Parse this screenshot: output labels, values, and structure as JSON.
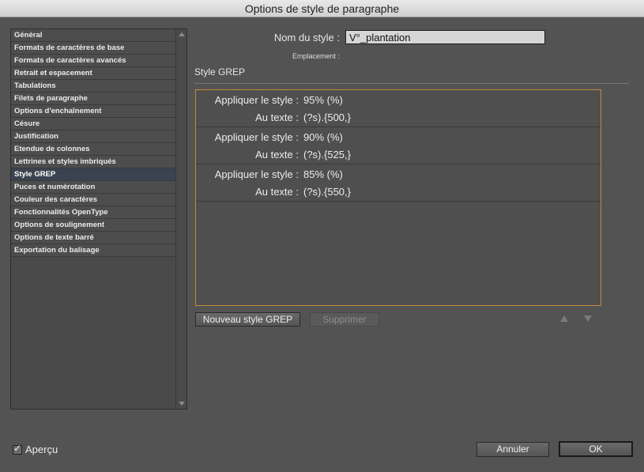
{
  "window": {
    "title": "Options de style de paragraphe"
  },
  "sidebar": {
    "items": [
      {
        "label": "Général",
        "selected": false
      },
      {
        "label": "Formats de caractères de base",
        "selected": false
      },
      {
        "label": "Formats de caractères avancés",
        "selected": false
      },
      {
        "label": "Retrait et espacement",
        "selected": false
      },
      {
        "label": "Tabulations",
        "selected": false
      },
      {
        "label": "Filets de paragraphe",
        "selected": false
      },
      {
        "label": "Options d'enchaînement",
        "selected": false
      },
      {
        "label": "Césure",
        "selected": false
      },
      {
        "label": "Justification",
        "selected": false
      },
      {
        "label": "Etendue de colonnes",
        "selected": false
      },
      {
        "label": "Lettrines et styles imbriqués",
        "selected": false
      },
      {
        "label": "Style GREP",
        "selected": true
      },
      {
        "label": "Puces et numérotation",
        "selected": false
      },
      {
        "label": "Couleur des caractères",
        "selected": false
      },
      {
        "label": "Fonctionnalités OpenType",
        "selected": false
      },
      {
        "label": "Options de soulignement",
        "selected": false
      },
      {
        "label": "Options de texte barré",
        "selected": false
      },
      {
        "label": "Exportation du balisage",
        "selected": false
      }
    ]
  },
  "header": {
    "style_name_label": "Nom du style :",
    "style_name_value": "V°_plantation",
    "location_label": "Emplacement :"
  },
  "section": {
    "title": "Style GREP"
  },
  "grep_rules": [
    {
      "apply_label": "Appliquer le style :",
      "apply_value": "95% (%)",
      "text_label": "Au texte :",
      "text_value": "(?s).{500,}"
    },
    {
      "apply_label": "Appliquer le style :",
      "apply_value": "90% (%)",
      "text_label": "Au texte :",
      "text_value": "(?s).{525,}"
    },
    {
      "apply_label": "Appliquer le style :",
      "apply_value": "85% (%)",
      "text_label": "Au texte :",
      "text_value": "(?s).{550,}"
    }
  ],
  "buttons": {
    "new_grep": "Nouveau style GREP",
    "delete": "Supprimer",
    "cancel": "Annuler",
    "ok": "OK"
  },
  "preview": {
    "label": "Aperçu",
    "checked": true
  },
  "colors": {
    "accent_border": "#c78a3a",
    "selected_item": "#3b4350"
  }
}
